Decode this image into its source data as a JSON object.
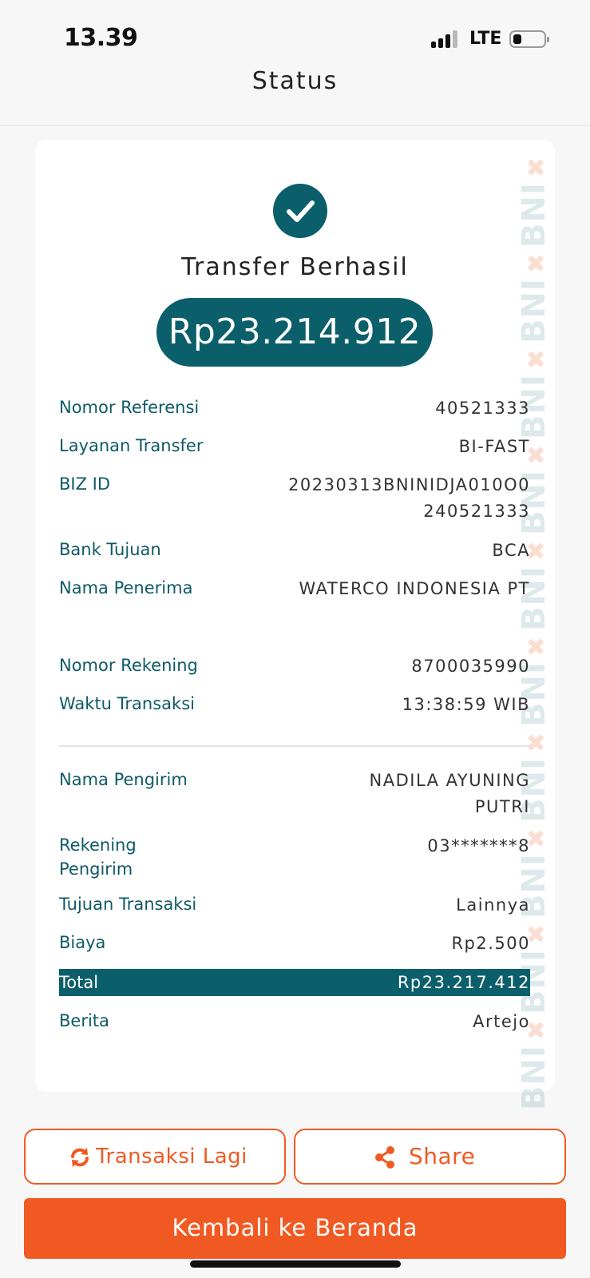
{
  "status_bar": {
    "time": "13.39",
    "network": "LTE"
  },
  "header": {
    "title": "Status"
  },
  "receipt": {
    "title": "Transfer Berhasil",
    "amount": "Rp23.214.912",
    "watermark": "BNI",
    "details": [
      {
        "label": "Nomor Referensi",
        "value": "40521333"
      },
      {
        "label": "Layanan Transfer",
        "value": "BI-FAST"
      },
      {
        "label": "BIZ ID",
        "value": "20230313BNINIDJA010O0240521333"
      },
      {
        "label": "Bank Tujuan",
        "value": "BCA"
      },
      {
        "label": "Nama Penerima",
        "value": "WATERCO INDONESIA PT"
      },
      {
        "label": "Nomor Rekening",
        "value": "8700035990"
      },
      {
        "label": "Waktu Transaksi",
        "value": "13:38:59 WIB"
      }
    ],
    "sender": [
      {
        "label": "Nama Pengirim",
        "value": "NADILA AYUNING PUTRI"
      },
      {
        "label": "Rekening Pengirim",
        "value": "03*******8"
      },
      {
        "label": "Tujuan Transaksi",
        "value": "Lainnya"
      },
      {
        "label": "Biaya",
        "value": "Rp2.500"
      },
      {
        "label": "Total",
        "value": "Rp23.217.412"
      },
      {
        "label": "Berita",
        "value": "Artejo"
      }
    ]
  },
  "actions": {
    "repeat_label": "Transaksi Lagi",
    "share_label": "Share",
    "home_label": "Kembali ke Beranda"
  },
  "colors": {
    "primary": "#0b5f6a",
    "accent": "#f05a22",
    "watermark_teal": "#0b5f6a",
    "watermark_orange": "#f05a22"
  }
}
